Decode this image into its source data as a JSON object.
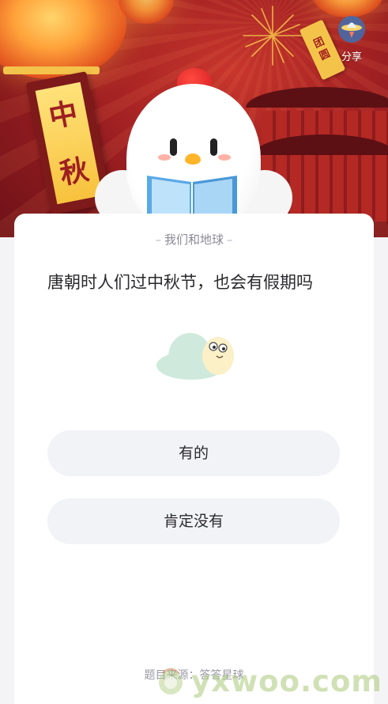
{
  "banner": {
    "banner_characters": [
      "中",
      "秋"
    ],
    "tag_characters": [
      "团",
      "圆"
    ]
  },
  "share": {
    "label": "分享",
    "icon": "share-icon"
  },
  "card": {
    "category": "我们和地球",
    "question": "唐朝时人们过中秋节，也会有假期吗",
    "options": [
      {
        "label": "有的"
      },
      {
        "label": "肯定没有"
      }
    ],
    "source": "题目来源：答答星球"
  },
  "watermark": {
    "text": "yxwoo.com"
  },
  "colors": {
    "banner_red": "#9e1f22",
    "card_bg": "#ffffff",
    "option_bg": "#f2f3f6",
    "text_primary": "#2a2a2e",
    "text_muted": "#8a8a96"
  }
}
